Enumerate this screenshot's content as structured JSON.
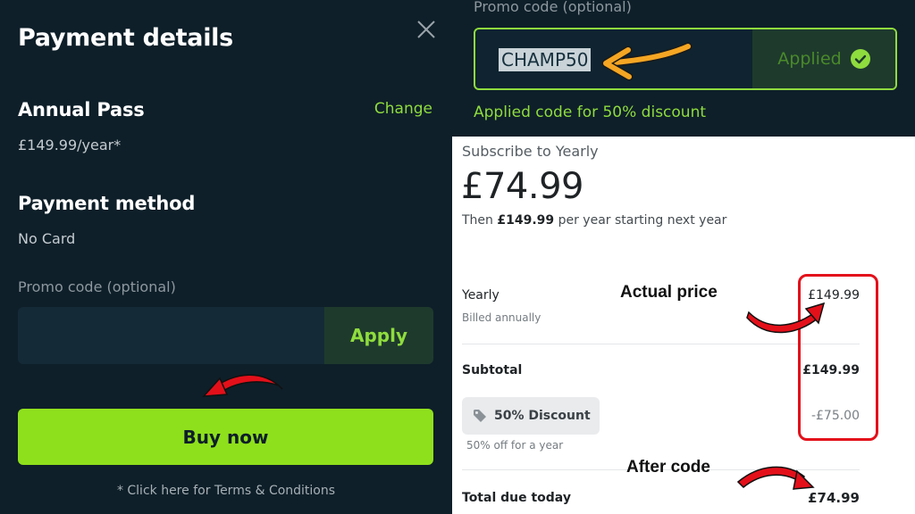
{
  "left_panel": {
    "title": "Payment details",
    "plan_name": "Annual Pass",
    "change_label": "Change",
    "plan_price": "£149.99/year*",
    "payment_method_title": "Payment method",
    "payment_method_value": "No Card",
    "promo_label": "Promo code (optional)",
    "promo_value": "",
    "apply_label": "Apply",
    "buy_label": "Buy now",
    "terms_label": "* Click here for Terms & Conditions"
  },
  "right_top": {
    "promo_label": "Promo code (optional)",
    "promo_value": "CHAMP50",
    "applied_label": "Applied",
    "applied_message": "Applied code for 50% discount"
  },
  "summary": {
    "subscribe_title": "Subscribe to Yearly",
    "price": "£74.99",
    "then_prefix": "Then",
    "then_amount": "£149.99",
    "then_suffix": "per year starting next year",
    "yearly_label": "Yearly",
    "yearly_sub": "Billed annually",
    "yearly_amount": "£149.99",
    "subtotal_label": "Subtotal",
    "subtotal_amount": "£149.99",
    "discount_label": "50% Discount",
    "discount_sub": "50% off for a year",
    "discount_amount": "-£75.00",
    "total_label": "Total due today",
    "total_amount": "£74.99"
  },
  "annotations": {
    "actual_price": "Actual price",
    "after_code": "After code"
  },
  "colors": {
    "dark_bg": "#0e1f29",
    "accent_green": "#8fe01c",
    "annotation_red": "#e3101a",
    "arrow_orange": "#f5a623"
  },
  "icons": [
    "close-icon",
    "check-icon",
    "tag-icon",
    "arrow-icon"
  ]
}
